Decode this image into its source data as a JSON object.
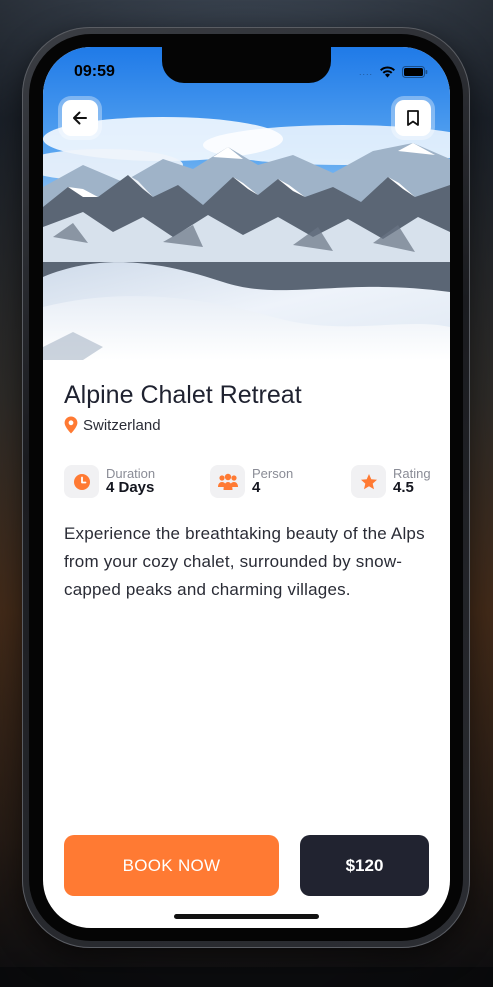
{
  "status_bar": {
    "time": "09:59",
    "signal": "....",
    "wifi_icon": "wifi-icon",
    "battery_icon": "battery-icon"
  },
  "hero": {
    "image": "snowy-alpine-mountains",
    "back_icon": "arrow-left-icon",
    "bookmark_icon": "bookmark-icon"
  },
  "listing": {
    "title": "Alpine Chalet Retreat",
    "location": "Switzerland",
    "location_icon": "map-pin-icon"
  },
  "stats": [
    {
      "icon": "clock-icon",
      "label": "Duration",
      "value": "4 Days"
    },
    {
      "icon": "people-icon",
      "label": "Person",
      "value": "4"
    },
    {
      "icon": "star-icon",
      "label": "Rating",
      "value": "4.5"
    }
  ],
  "description": "Experience the breathtaking beauty of the Alps from your cozy chalet, surrounded by snow-capped peaks and charming villages.",
  "actions": {
    "book_label": "BOOK NOW",
    "price_label": "$120"
  },
  "colors": {
    "accent": "#ff7a33",
    "dark": "#212330",
    "icon_bg": "#f1f1f3"
  }
}
